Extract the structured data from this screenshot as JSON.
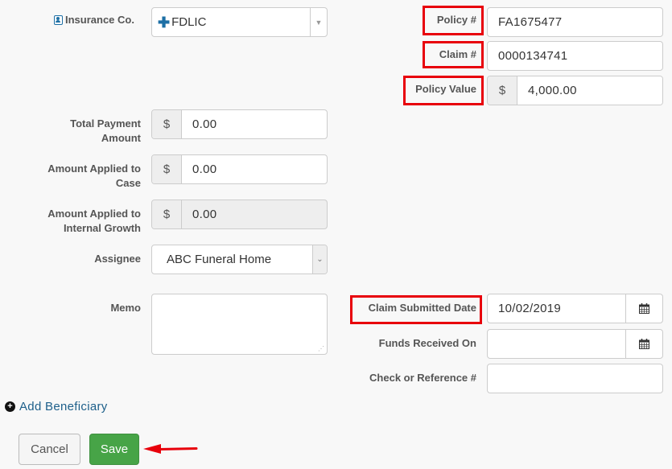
{
  "left": {
    "insurance_co": {
      "label": "Insurance Co.",
      "value": "FDLIC"
    },
    "total_payment": {
      "label_line1": "Total Payment",
      "label_line2": "Amount",
      "currency": "$",
      "value": "0.00"
    },
    "applied_case": {
      "label_line1": "Amount Applied to",
      "label_line2": "Case",
      "currency": "$",
      "value": "0.00"
    },
    "applied_growth": {
      "label_line1": "Amount Applied to",
      "label_line2": "Internal Growth",
      "currency": "$",
      "value": "0.00"
    },
    "assignee": {
      "label": "Assignee",
      "value": "ABC Funeral Home"
    },
    "memo": {
      "label": "Memo",
      "value": ""
    }
  },
  "right": {
    "policy_num": {
      "label": "Policy #",
      "value": "FA1675477"
    },
    "claim_num": {
      "label": "Claim #",
      "value": "0000134741"
    },
    "policy_value": {
      "label": "Policy Value",
      "currency": "$",
      "value": "4,000.00"
    },
    "claim_submitted": {
      "label": "Claim Submitted Date",
      "value": "10/02/2019"
    },
    "funds_received": {
      "label": "Funds Received On",
      "value": ""
    },
    "check_ref": {
      "label": "Check or Reference #",
      "value": ""
    }
  },
  "add_beneficiary": "Add Beneficiary",
  "buttons": {
    "cancel": "Cancel",
    "save": "Save"
  },
  "colors": {
    "highlight": "#e8000b",
    "save": "#47a447",
    "link": "#1d5f8a",
    "icon_blue": "#1d6fa5"
  }
}
